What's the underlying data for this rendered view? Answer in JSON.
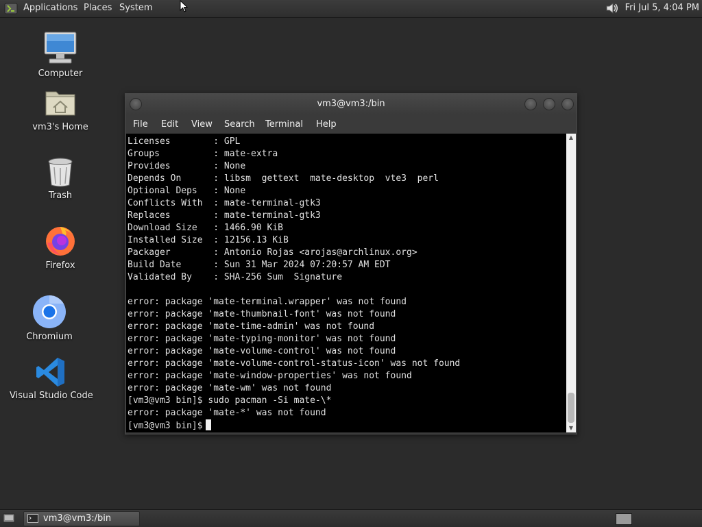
{
  "top_panel": {
    "menus": [
      "Applications",
      "Places",
      "System"
    ],
    "clock": "Fri Jul  5,  4:04 PM",
    "icons": {
      "logo": "mate-logo-icon",
      "volume": "speaker-icon"
    }
  },
  "desktop": {
    "icons": [
      {
        "label": "Computer",
        "icon": "computer-icon"
      },
      {
        "label": "vm3's Home",
        "icon": "home-folder-icon"
      },
      {
        "label": "Trash",
        "icon": "trash-icon"
      },
      {
        "label": "Firefox",
        "icon": "firefox-icon"
      },
      {
        "label": "Chromium",
        "icon": "chromium-icon"
      },
      {
        "label": "Visual Studio Code",
        "icon": "vscode-icon"
      }
    ]
  },
  "terminal": {
    "title": "vm3@vm3:/bin",
    "menu": [
      "File",
      "Edit",
      "View",
      "Search",
      "Terminal",
      "Help"
    ],
    "lines": [
      "Licenses        : GPL",
      "Groups          : mate-extra",
      "Provides        : None",
      "Depends On      : libsm  gettext  mate-desktop  vte3  perl",
      "Optional Deps   : None",
      "Conflicts With  : mate-terminal-gtk3",
      "Replaces        : mate-terminal-gtk3",
      "Download Size   : 1466.90 KiB",
      "Installed Size  : 12156.13 KiB",
      "Packager        : Antonio Rojas <arojas@archlinux.org>",
      "Build Date      : Sun 31 Mar 2024 07:20:57 AM EDT",
      "Validated By    : SHA-256 Sum  Signature",
      "",
      "error: package 'mate-terminal.wrapper' was not found",
      "error: package 'mate-thumbnail-font' was not found",
      "error: package 'mate-time-admin' was not found",
      "error: package 'mate-typing-monitor' was not found",
      "error: package 'mate-volume-control' was not found",
      "error: package 'mate-volume-control-status-icon' was not found",
      "error: package 'mate-window-properties' was not found",
      "error: package 'mate-wm' was not found",
      "[vm3@vm3 bin]$ sudo pacman -Si mate-\\*",
      "error: package 'mate-*' was not found"
    ],
    "prompt": "[vm3@vm3 bin]$"
  },
  "bottom_panel": {
    "task_label": "vm3@vm3:/bin",
    "icons": {
      "show_desktop": "show-desktop-icon",
      "task": "terminal-icon",
      "workspace": "workspace-switcher-icon"
    }
  },
  "colors": {
    "desktop_bg": "#2b2b2b",
    "terminal_bg": "#000000",
    "terminal_fg": "#e0e0e0",
    "chrome_bg": "#3a3a3a",
    "vscode_blue": "#2a8ae0",
    "chromium_blue": "#1a73e8",
    "firefox_orange": "#ff7139"
  }
}
